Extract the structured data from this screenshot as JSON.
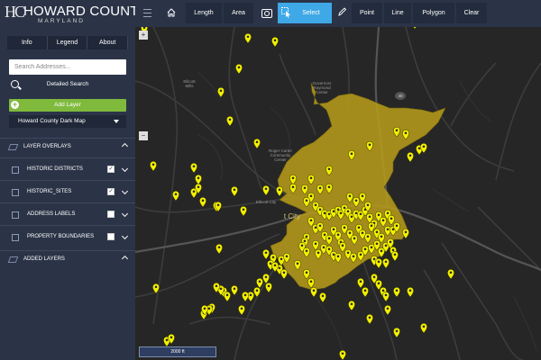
{
  "branding": {
    "monogram": "HC",
    "name": "HOWARD COUNTY",
    "subname": "MARYLAND"
  },
  "sidebar": {
    "tabs": [
      "Info",
      "Legend",
      "About"
    ],
    "search_placeholder": "Search Addresses...",
    "detailed_search": "Detailed Search",
    "add_layer": "Add Layer",
    "basemap": "Howard County Dark Map",
    "layer_overlays": "LAYER OVERLAYS",
    "layers": [
      {
        "label": "HISTORIC DISTRICTS",
        "checked": true
      },
      {
        "label": "HISTORIC_SITES",
        "checked": true
      },
      {
        "label": "ADDRESS LABELS",
        "checked": false
      },
      {
        "label": "PROPERTY BOUNDARIES",
        "checked": false
      }
    ],
    "added_layers": "ADDED LAYERS"
  },
  "toolbar": {
    "length": "Length",
    "area": "Area",
    "select": "Select",
    "point": "Point",
    "line": "Line",
    "polygon": "Polygon",
    "clear": "Clear",
    "active_tool": "Select",
    "accent_color": "#3fa8e6"
  },
  "map": {
    "zoom_in": "+",
    "zoom_out": "−",
    "scale_label": "2000 ft",
    "labels": {
      "ellicott_mills": "Ellicott Mills",
      "gov_center": "Governors Raymond Center",
      "roger_carter": "Roger Carter Community Center",
      "ellicott_city": "Ellicott City",
      "ellicott_city_partial": "t City",
      "route_40": "40"
    },
    "district_color": "#b59b1a",
    "marker_color": "#f3f000"
  }
}
